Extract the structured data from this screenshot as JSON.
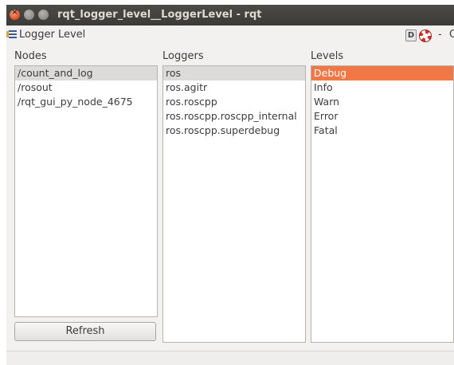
{
  "window": {
    "title": "rqt_logger_level__LoggerLevel - rqt"
  },
  "plugin": {
    "title": "Logger Level",
    "d_label": "D",
    "dash": "-",
    "close": "C"
  },
  "nodes": {
    "label": "Nodes",
    "items": [
      "/count_and_log",
      "/rosout",
      "/rqt_gui_py_node_4675"
    ],
    "selected": "/count_and_log"
  },
  "loggers": {
    "label": "Loggers",
    "items": [
      "ros",
      "ros.agitr",
      "ros.roscpp",
      "ros.roscpp.roscpp_internal",
      "ros.roscpp.superdebug"
    ],
    "selected": "ros"
  },
  "levels": {
    "label": "Levels",
    "items": [
      "Debug",
      "Info",
      "Warn",
      "Error",
      "Fatal"
    ],
    "selected": "Debug"
  },
  "refresh_label": "Refresh",
  "colors": {
    "selection_accent": "#f07746",
    "titlebar": "#3c3b37",
    "window_bg": "#f2f1f0"
  }
}
